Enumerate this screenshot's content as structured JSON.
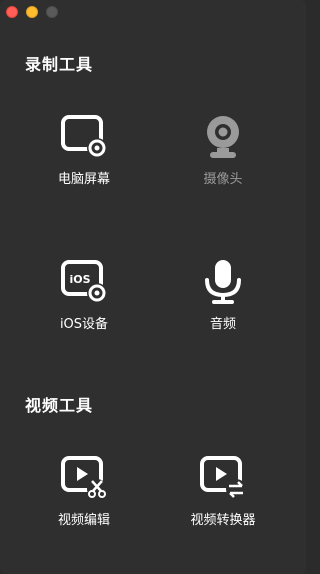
{
  "sections": [
    {
      "title": "录制工具",
      "tools": [
        {
          "label": "电脑屏幕",
          "icon": "screen-record-icon",
          "enabled": true
        },
        {
          "label": "摄像头",
          "icon": "webcam-icon",
          "enabled": false
        },
        {
          "label": "iOS设备",
          "icon": "ios-device-icon",
          "enabled": true
        },
        {
          "label": "音频",
          "icon": "microphone-icon",
          "enabled": true
        }
      ]
    },
    {
      "title": "视频工具",
      "tools": [
        {
          "label": "视频编辑",
          "icon": "video-edit-icon",
          "enabled": true
        },
        {
          "label": "视频转换器",
          "icon": "video-convert-icon",
          "enabled": true
        }
      ]
    }
  ],
  "icon_text": {
    "ios": "iOS"
  },
  "colors": {
    "background": "#2f2f2f",
    "icon": "#ffffff",
    "disabled": "#9a9a9a",
    "close": "#ff5f57",
    "minimize": "#febc2e",
    "zoom": "#5a5a5a"
  }
}
